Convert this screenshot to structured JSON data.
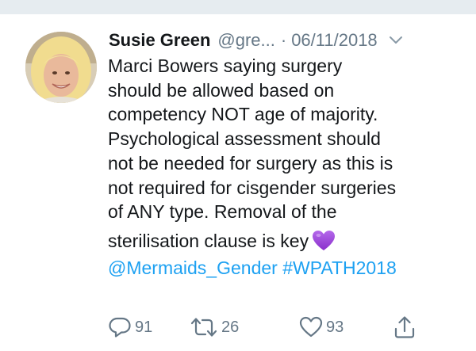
{
  "tweet": {
    "author_name": "Susie Green",
    "handle": "@gre...",
    "separator": "·",
    "date": "06/11/2018",
    "avatar_icon": "avatar-photo-icon",
    "lines": [
      "Marci Bowers saying surgery",
      "should be allowed based on",
      "competency NOT age of majority.",
      "Psychological assessment should",
      "not be needed for surgery as this is",
      "not required for cisgender surgeries",
      "of ANY type. Removal of the",
      "sterilisation clause is key"
    ],
    "emoji": "purple-heart-icon",
    "mention": "@Mermaids_Gender",
    "hashtag": "#WPATH2018"
  },
  "actions": {
    "reply_count": "91",
    "retweet_count": "26",
    "like_count": "93",
    "reply_icon": "reply-icon",
    "retweet_icon": "retweet-icon",
    "like_icon": "heart-outline-icon",
    "share_icon": "share-icon"
  },
  "colors": {
    "link": "#1da1f2",
    "secondary_text": "#657786",
    "emoji_heart": "#9b3fd6"
  }
}
